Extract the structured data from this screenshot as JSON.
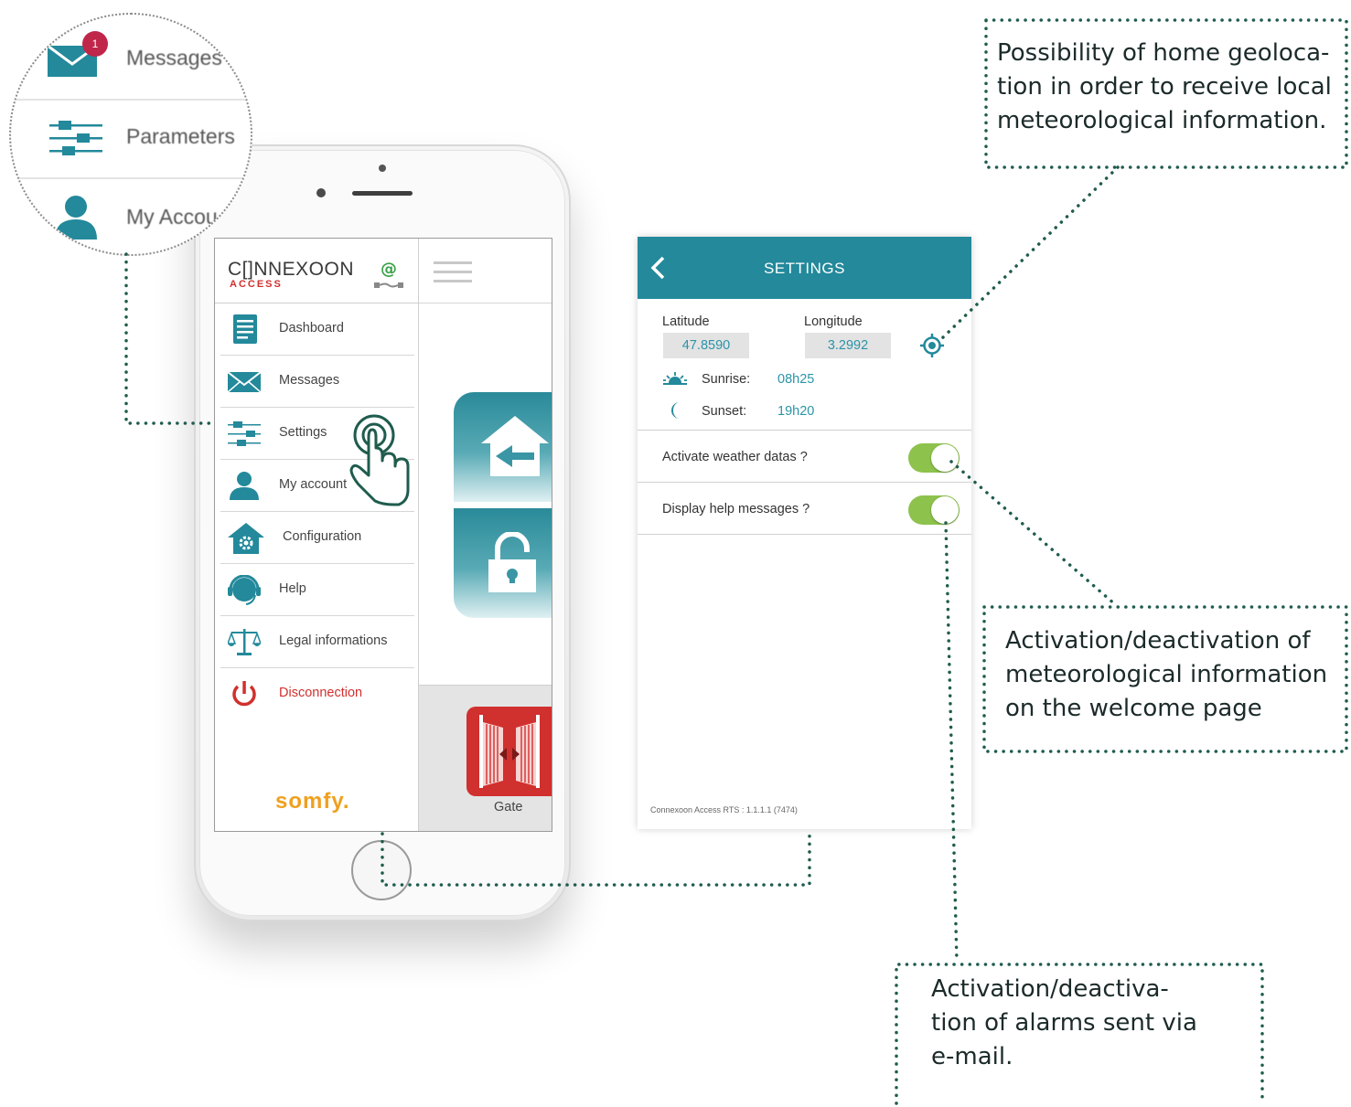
{
  "zoom": {
    "items": [
      {
        "label": "Messages",
        "icon": "envelope-icon",
        "badge": "1"
      },
      {
        "label": "Parameters",
        "icon": "sliders-icon"
      },
      {
        "label": "My Accou",
        "icon": "user-icon"
      }
    ]
  },
  "app": {
    "brand": "C[]NNEXOON",
    "brand_sub": "ACCESS",
    "status_icon": "at-icon",
    "menu_icon": "hamburger-icon",
    "footer_logo": "somfy.",
    "menu": [
      {
        "label": "Dashboard",
        "icon": "dashboard-icon"
      },
      {
        "label": "Messages",
        "icon": "envelope-icon"
      },
      {
        "label": "Settings",
        "icon": "sliders-icon"
      },
      {
        "label": "My account",
        "icon": "user-icon"
      },
      {
        "label": "Configuration",
        "icon": "house-gear-icon"
      },
      {
        "label": "Help",
        "icon": "headset-icon"
      },
      {
        "label": "Legal informations",
        "icon": "scales-icon"
      },
      {
        "label": "Disconnection",
        "icon": "power-icon"
      }
    ],
    "tiles": [
      {
        "icon": "house-arrow-icon"
      },
      {
        "icon": "unlock-icon"
      }
    ],
    "gate_label": "Gate",
    "gate_icon": "gate-icon",
    "hand_icon": "tap-hand-icon"
  },
  "settings": {
    "title": "SETTINGS",
    "back_icon": "chevron-left-icon",
    "latitude_label": "Latitude",
    "latitude_value": "47.8590",
    "longitude_label": "Longitude",
    "longitude_value": "3.2992",
    "locate_icon": "crosshair-icon",
    "sunrise_label": "Sunrise:",
    "sunrise_value": "08h25",
    "sunset_label": "Sunset:",
    "sunset_value": "19h20",
    "weather_label": "Activate weather datas ?",
    "weather_on": true,
    "help_label": "Display help messages ?",
    "help_on": true,
    "version": "Connexoon Access RTS : 1.1.1.1 (7474)"
  },
  "callouts": {
    "geo": [
      "Possibility of home geoloca-",
      "tion in order to receive local",
      "meteorological information."
    ],
    "weather": [
      "Activation/deactivation of",
      "meteorological information",
      "on the welcome page"
    ],
    "alarms": [
      "Activation/deactiva-",
      "tion of alarms sent via",
      "e-mail."
    ]
  },
  "colors": {
    "teal": "#23899b",
    "green": "#8dc24c",
    "red": "#d0302e",
    "callout_line": "#1f5c4e"
  }
}
